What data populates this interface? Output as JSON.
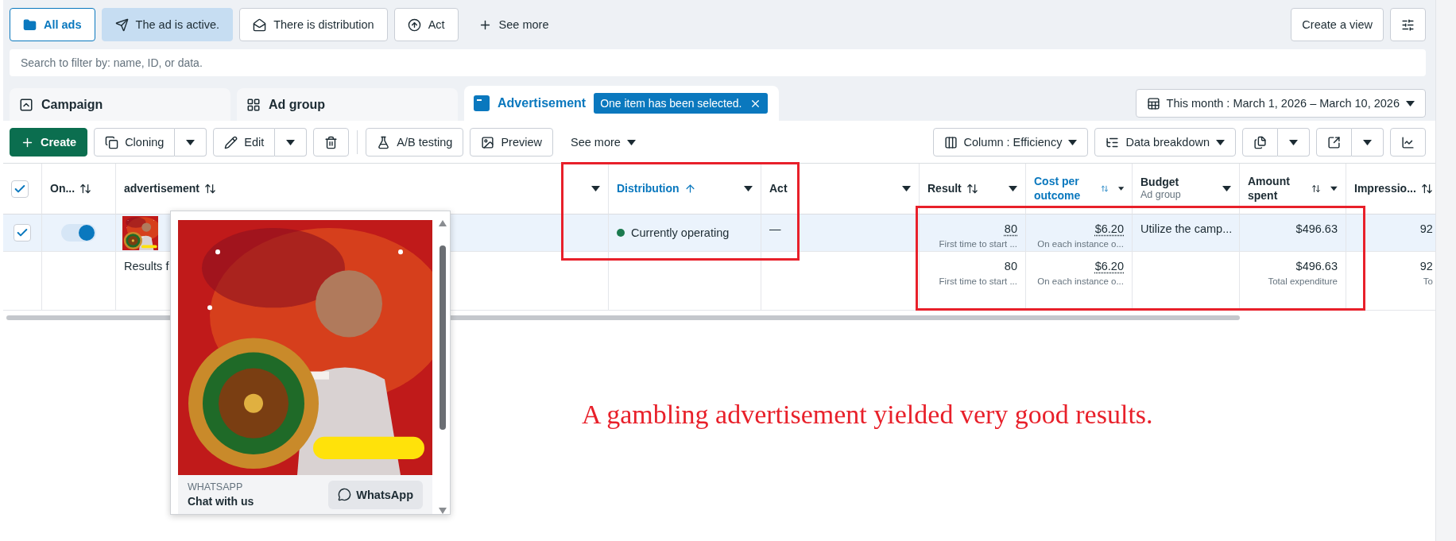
{
  "filters": [
    {
      "kind": "view",
      "label": "All ads",
      "selected": true
    },
    {
      "kind": "filter",
      "label": "The ad is active.",
      "selected": true
    },
    {
      "kind": "filter",
      "label": "There is distribution",
      "selected": false
    },
    {
      "kind": "filter",
      "label": "Act",
      "selected": false
    },
    {
      "kind": "more",
      "label": "See more"
    }
  ],
  "create_view": "Create a view",
  "search": {
    "placeholder": "Search to filter by: name, ID, or data."
  },
  "levels": [
    {
      "label": "Campaign",
      "selected": false
    },
    {
      "label": "Ad group",
      "selected": false
    },
    {
      "label": "Advertisement",
      "selected": true,
      "badge": "One item has been selected."
    }
  ],
  "date_range": "This month : March 1, 2026 – March 10, 2026",
  "toolbar": {
    "left": [
      {
        "kind": "primary",
        "label": "Create"
      },
      {
        "kind": "split",
        "label": "Cloning"
      },
      {
        "kind": "split",
        "label": "Edit"
      },
      {
        "kind": "icon"
      },
      {
        "kind": "plain",
        "label": "A/B testing"
      },
      {
        "kind": "plain",
        "label": "Preview"
      },
      {
        "kind": "menu",
        "label": "See more"
      }
    ],
    "right": [
      {
        "kind": "menu",
        "label": "Column : Efficiency"
      },
      {
        "kind": "menu",
        "label": "Data breakdown"
      },
      {
        "kind": "split-icon"
      },
      {
        "kind": "split-icon"
      },
      {
        "kind": "icon"
      }
    ]
  },
  "table": {
    "header_checked": true,
    "columns": [
      {
        "label": "On...",
        "sortable": true,
        "menu": false
      },
      {
        "label": "advertisement",
        "sortable": true,
        "menu": true
      },
      {
        "label": "Distribution",
        "sortable": true,
        "sorted_ascending": true,
        "highlighted": true,
        "menu": true
      },
      {
        "label": "Act",
        "sortable": false,
        "menu": true
      },
      {
        "label": "Result",
        "sortable": true,
        "menu": true
      },
      {
        "label": "Cost per outcome",
        "sortable": true,
        "highlighted": true,
        "menu": true
      },
      {
        "label": "Budget",
        "sub": "Ad group",
        "sortable": false,
        "menu": true
      },
      {
        "label": "Amount spent",
        "sortable": true,
        "menu": true
      },
      {
        "label": "Impressio...",
        "sortable": true,
        "menu": false
      }
    ],
    "rows": [
      {
        "kind": "ad",
        "checked": true,
        "on": true,
        "distribution": {
          "text": "Currently operating",
          "color": "#1b7a4f"
        },
        "act": "—",
        "result": {
          "value": "80",
          "note": "First time to start ...",
          "dotted": true
        },
        "cost": {
          "value": "$6.20",
          "note": "On each instance o...",
          "dotted": true
        },
        "budget": {
          "value": "Utilize the camp..."
        },
        "amount": {
          "value": "$496.63"
        },
        "impressions": {
          "value": "92"
        }
      },
      {
        "kind": "summary",
        "label": "Results f",
        "result": {
          "value": "80",
          "note": "First time to start ...",
          "dotted": false
        },
        "cost": {
          "value": "$6.20",
          "note": "On each instance o...",
          "dotted": true
        },
        "amount": {
          "value": "$496.63",
          "note": "Total expenditure"
        },
        "impressions": {
          "value": "92",
          "note": "To"
        }
      }
    ]
  },
  "preview": {
    "label": "WHATSAPP",
    "title": "Chat with us",
    "button": "WhatsApp"
  },
  "annotation": {
    "caption": "A gambling advertisement yielded very good results."
  }
}
